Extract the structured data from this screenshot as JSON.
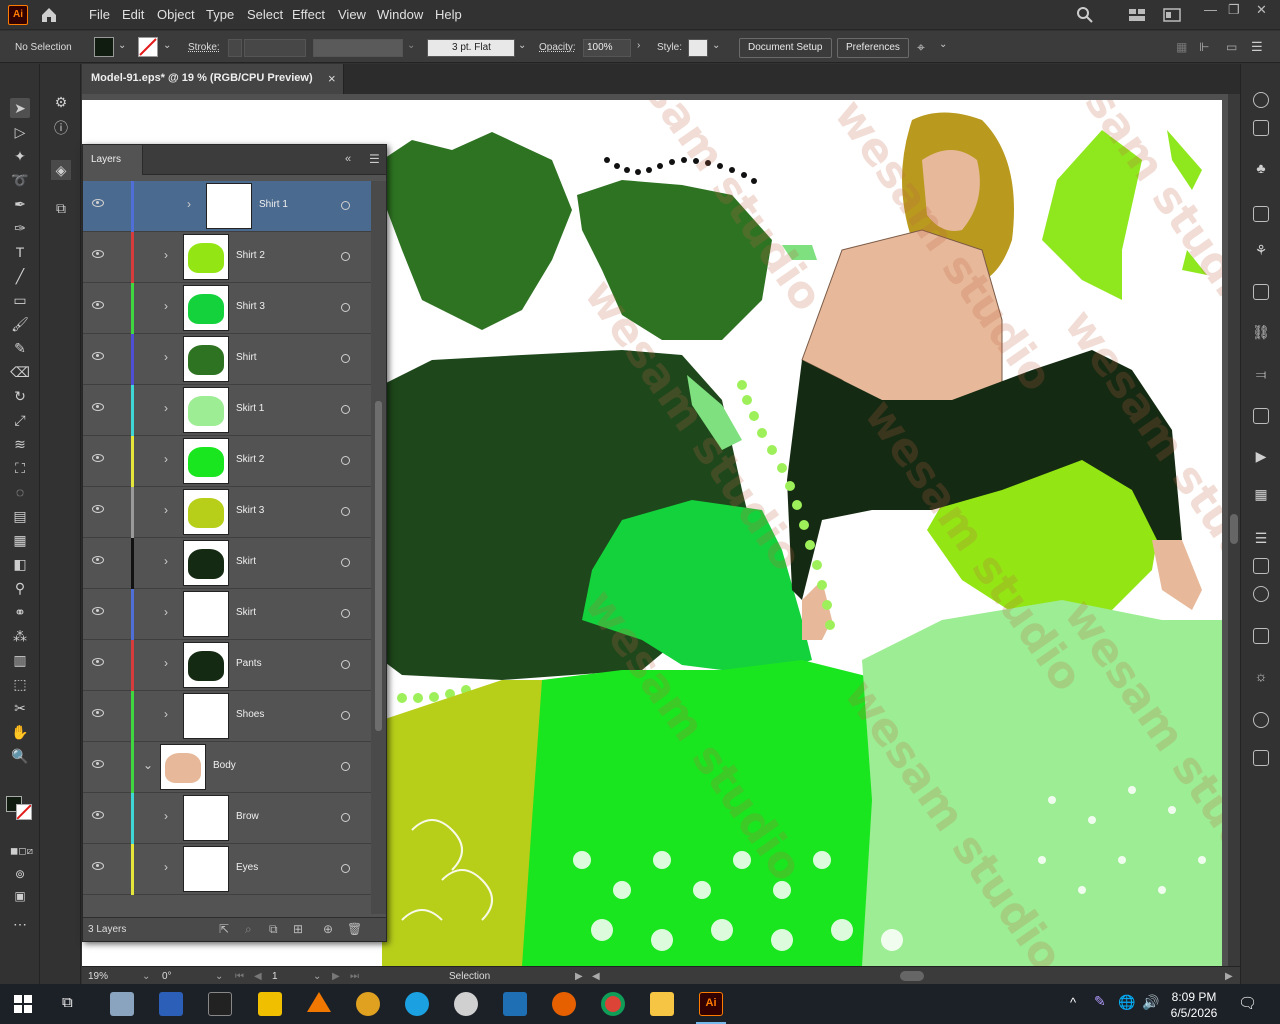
{
  "app": {
    "logo": "Ai"
  },
  "menu": [
    "File",
    "Edit",
    "Object",
    "Type",
    "Select",
    "Effect",
    "View",
    "Window",
    "Help"
  ],
  "control_bar": {
    "selection_status": "No Selection",
    "stroke_label": "Stroke:",
    "brush": "3 pt. Flat",
    "opacity_label": "Opacity:",
    "opacity_value": "100%",
    "style_label": "Style:",
    "document_setup": "Document Setup",
    "preferences": "Preferences",
    "fill_color": "#0f1c0f"
  },
  "document_tab": {
    "title": "Model-91.eps* @ 19 % (RGB/CPU Preview)",
    "close": "×"
  },
  "layers_panel": {
    "title": "Layers",
    "layer_count": "3 Layers",
    "rows": [
      {
        "name": "Shirt 1",
        "color": "#4f6fd6",
        "selected": true
      },
      {
        "name": "Shirt 2",
        "color": "#d63c3c"
      },
      {
        "name": "Shirt 3",
        "color": "#3fd63f"
      },
      {
        "name": "Shirt",
        "color": "#4f4fd6"
      },
      {
        "name": "Skirt 1",
        "color": "#3fd6d6"
      },
      {
        "name": "Skirt 2",
        "color": "#e6e63a"
      },
      {
        "name": "Skirt 3",
        "color": "#9a9a9a"
      },
      {
        "name": "Skirt",
        "color": "#111111"
      },
      {
        "name": "Skirt",
        "color": "#4f6fd6"
      },
      {
        "name": "Pants",
        "color": "#d63c3c"
      },
      {
        "name": "Shoes",
        "color": "#3fd63f"
      },
      {
        "name": "Body",
        "color": "#3fd63f"
      },
      {
        "name": "Brow",
        "color": "#3fd6d6"
      },
      {
        "name": "Eyes",
        "color": "#e6e63a"
      }
    ]
  },
  "status_bar": {
    "zoom": "19%",
    "rotation": "0°",
    "artboard": "1",
    "tool": "Selection"
  },
  "taskbar": {
    "time": "8:09 PM",
    "date": "6/5/2026"
  },
  "watermark": "wesam studio"
}
